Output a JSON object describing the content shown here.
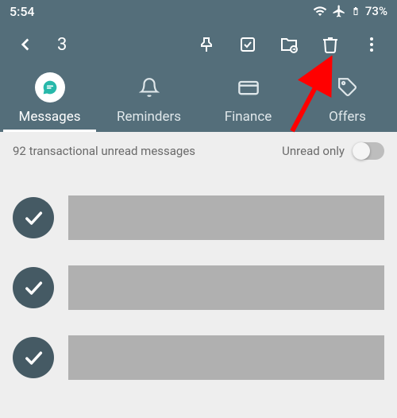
{
  "status": {
    "time": "5:54",
    "battery": "73%"
  },
  "toolbar": {
    "selected_count": "3"
  },
  "tabs": [
    {
      "label": "Messages",
      "active": true
    },
    {
      "label": "Reminders",
      "active": false
    },
    {
      "label": "Finance",
      "active": false
    },
    {
      "label": "Offers",
      "active": false
    }
  ],
  "filter": {
    "summary": "92  transactional unread messages",
    "toggle_label": "Unread only",
    "toggle_on": false
  },
  "colors": {
    "appbar": "#546e7a",
    "selected": "#455a64",
    "accent": "#27b8aa"
  },
  "annotation": {
    "points_to": "delete-button"
  }
}
